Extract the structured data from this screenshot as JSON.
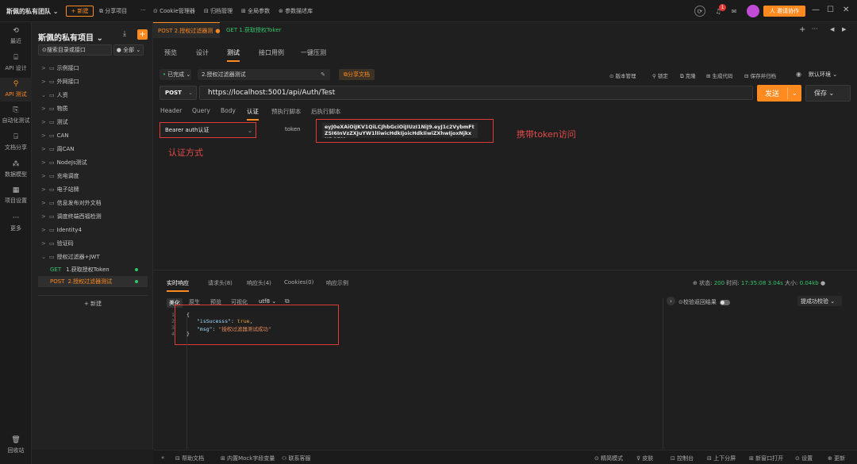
{
  "titlebar": {
    "team": "斯佩的私有团队 ⌄",
    "new_button": "+ 新建",
    "share_project": "⧉ 分享项目",
    "more": "···",
    "cookie_manager": "⊙ Cookie管理器",
    "archive_manager": "⊟ 归档管理",
    "global_params": "⊞ 全局参数",
    "params_description": "⊛ 参数描述库",
    "notification_count": "1",
    "invite_button": "⼈ 邀请协作"
  },
  "leftnav": {
    "items": [
      {
        "icon": "⟲",
        "label": "最近"
      },
      {
        "icon": "⌸",
        "label": "API 设计"
      },
      {
        "icon": "⚲",
        "label": "API 测试"
      },
      {
        "icon": "⎘",
        "label": "自动化测试"
      },
      {
        "icon": "⍈",
        "label": "文档分享"
      },
      {
        "icon": "⁂",
        "label": "数据模型"
      },
      {
        "icon": "▦",
        "label": "项目设置"
      },
      {
        "icon": "···",
        "label": "更多"
      }
    ],
    "trash": {
      "icon": "🗑",
      "label": "回收站"
    }
  },
  "tree": {
    "project_title": "斯佩的私有项目 ⌄",
    "search_placeholder": "⊙搜索目录或接口",
    "filter": "● 全部 ⌄",
    "folders": [
      {
        "chev": ">",
        "label": "示例接口"
      },
      {
        "chev": ">",
        "label": "外网接口"
      },
      {
        "chev": "⌄",
        "label": "人资"
      },
      {
        "chev": ">",
        "label": "物质"
      },
      {
        "chev": ">",
        "label": "测试"
      },
      {
        "chev": ">",
        "label": "CAN"
      },
      {
        "chev": ">",
        "label": "周CAN"
      },
      {
        "chev": ">",
        "label": "NodeJs测试"
      },
      {
        "chev": ">",
        "label": "充电调度"
      },
      {
        "chev": ">",
        "label": "电子站牌"
      },
      {
        "chev": ">",
        "label": "信息发布对外文档"
      },
      {
        "chev": ">",
        "label": "调度终端西福检测"
      },
      {
        "chev": ">",
        "label": "Identity4"
      },
      {
        "chev": ">",
        "label": "验证码"
      },
      {
        "chev": "⌄",
        "label": "授权过滤器+JWT"
      }
    ],
    "apis": [
      {
        "method": "GET",
        "label": "1.获取授权Token"
      },
      {
        "method": "POST",
        "label": "2.授权过滤器测试"
      }
    ],
    "new_label": "+ 新建"
  },
  "tabs": {
    "items": [
      {
        "label": "POST 2.授权过滤器测",
        "active": true
      },
      {
        "label": "GET 1.获取授权Toker",
        "active": false
      }
    ],
    "plus": "+",
    "more": "···"
  },
  "subtabs": [
    "预览",
    "设计",
    "测试",
    "接口用例",
    "一键压测"
  ],
  "toolbar": {
    "status_dot": "•",
    "status": "已完成 ⌄",
    "api_name": "2.授权过滤器测试",
    "share_doc": "⧉分享文档",
    "actions": [
      "⊙ 版本管理",
      "⚲ 锁定",
      "⧉ 克隆",
      "⊞ 生成代码",
      "⊟ 保存并归档"
    ],
    "env": "默认环境 ⌄"
  },
  "request": {
    "method": "POST",
    "url": "https://localhost:5001/api/Auth/Test",
    "send": "发送",
    "save": "保存 ⌄"
  },
  "reqtabs": [
    "Header",
    "Query",
    "Body",
    "认证",
    "预执行脚本",
    "后执行脚本"
  ],
  "auth": {
    "type": "Bearer auth认证",
    "token_label": "token",
    "token_value": "eyJ0eXAiOiJKV1QiLCJhbGciOiJIUzI1NiJ9.eyJ1c2VybmFtZSI6InVzZXJuYW1lIiwicHdkIjoicHdkIiwiZXhwIjoxNjkxNDQ5M",
    "annotation_type": "认证方式",
    "annotation_token": "携带token访问"
  },
  "response": {
    "tabs": [
      "实时响应",
      "请求头(8)",
      "响应头(4)",
      "Cookies(0)",
      "响应示例"
    ],
    "status_label": "状态:",
    "status_code": "200",
    "time_label": "时间:",
    "time": "17:35:08",
    "duration": "3.04s",
    "size_label": "大小:",
    "size": "0.04kb",
    "format_tabs": [
      "美化",
      "原生",
      "预览",
      "可视化",
      "utf8 ⌄"
    ],
    "check_result": "校验返回结果",
    "extract_check": "提成功校验 ⌄",
    "line_numbers": [
      "1",
      "2",
      "3",
      "4"
    ],
    "body": {
      "open": "{",
      "key1": "\"isSucesss\"",
      "val1": "true",
      "key2": "\"msg\"",
      "val2": "\"授权过滤器测试成功\"",
      "close": "}"
    }
  },
  "footer": {
    "items": [
      "⊟ 帮助文档",
      "⊞ 内置Mock字段变量",
      "⚇ 联系客服"
    ],
    "right_items": [
      "⊙ 精简模式",
      "⊽ 皮肤",
      "⊡ 控制台",
      "⊟ 上下分屏",
      "⊞ 新窗口打开",
      "⊙ 设置",
      "⊕ 更新"
    ]
  }
}
